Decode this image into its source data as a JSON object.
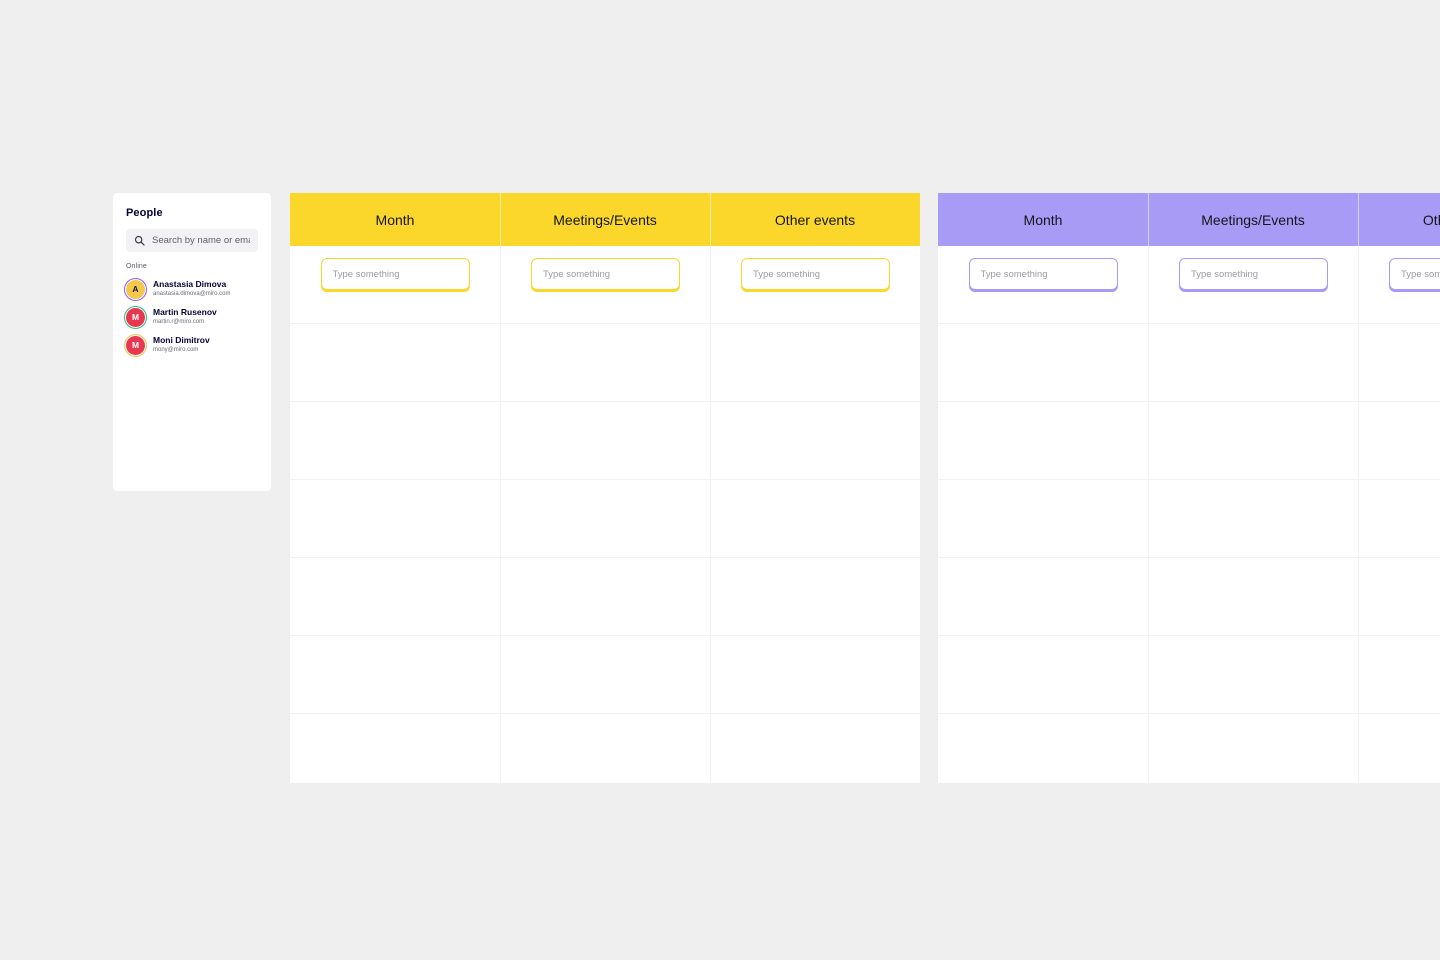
{
  "sidebar": {
    "title": "People",
    "search": {
      "icon": "search-icon",
      "placeholder": "Search by name or email",
      "value": ""
    },
    "section_label": "Online",
    "people": [
      {
        "name": "Anastasia Dimova",
        "email": "anastasia.dimova@miro.com",
        "initial": "A",
        "avatar_color": "#f5c84b",
        "ring_color": "#8b5cf6"
      },
      {
        "name": "Martin Rusenov",
        "email": "martin.r@miro.com",
        "initial": "M",
        "avatar_color": "#e8384f",
        "ring_color": "#2bbd7e"
      },
      {
        "name": "Moni Dimitrov",
        "email": "mony@miro.com",
        "initial": "M",
        "avatar_color": "#e8384f",
        "ring_color": "#f5c84b"
      }
    ]
  },
  "tables": [
    {
      "id": "yellow",
      "accent": "#fbd72c",
      "columns": [
        {
          "header": "Month",
          "input_placeholder": "Type something",
          "input_value": ""
        },
        {
          "header": "Meetings/Events",
          "input_placeholder": "Type something",
          "input_value": ""
        },
        {
          "header": "Other events",
          "input_placeholder": "Type something",
          "input_value": ""
        }
      ],
      "empty_rows": 6
    },
    {
      "id": "purple",
      "accent": "#a89bf6",
      "columns": [
        {
          "header": "Month",
          "input_placeholder": "Type something",
          "input_value": ""
        },
        {
          "header": "Meetings/Events",
          "input_placeholder": "Type something",
          "input_value": ""
        },
        {
          "header": "Other events",
          "input_placeholder": "Type something",
          "input_value": ""
        }
      ],
      "empty_rows": 6
    }
  ]
}
